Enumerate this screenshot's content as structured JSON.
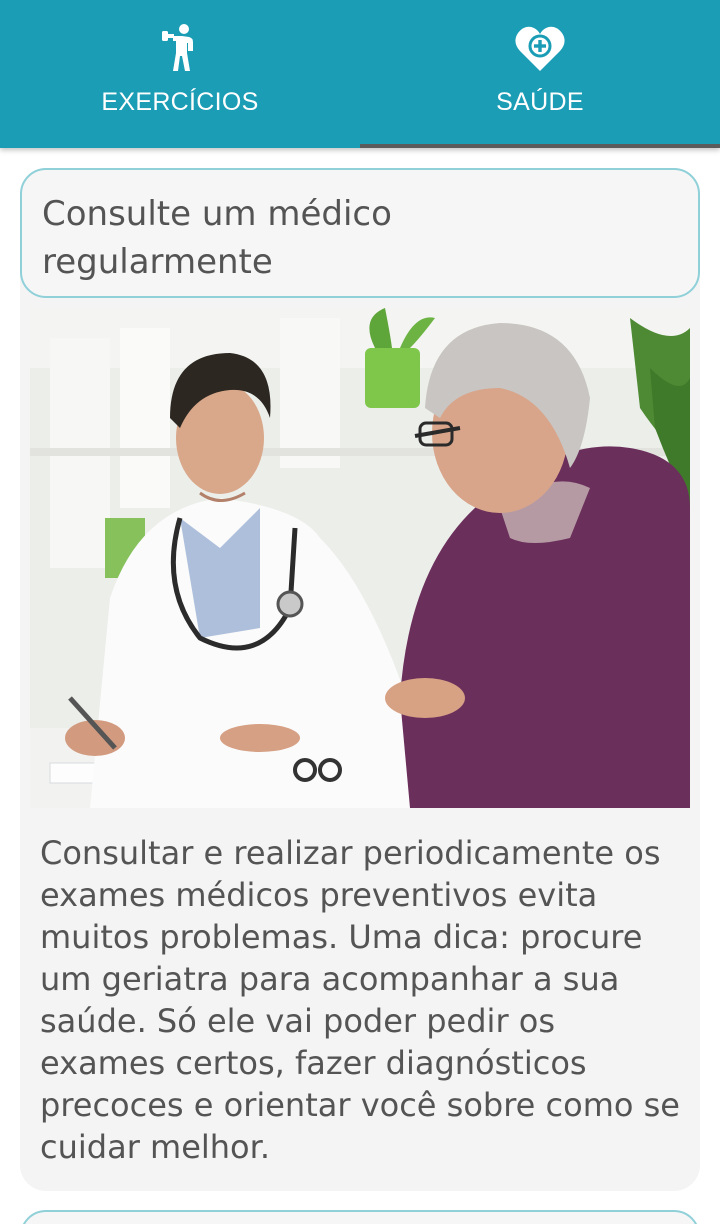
{
  "tabs": [
    {
      "label": "EXERCÍCIOS",
      "icon": "exercise-person-icon",
      "selected": false
    },
    {
      "label": "SAÚDE",
      "icon": "heart-plus-icon",
      "selected": true
    }
  ],
  "colors": {
    "primary": "#1a9db5",
    "indicator": "#5b5b5b",
    "card_border": "#8fd0d9",
    "card_bg": "#f4f4f4",
    "text": "#545454"
  },
  "card": {
    "title": "Consulte um médico regularmente",
    "image": "doctor-consulting-elderly-patient",
    "body": "Consultar e realizar periodicamente os exames médicos preventivos evita muitos problemas. Uma dica: procure um geriatra para acompanhar a sua saúde. Só ele vai poder pedir os exames certos, fazer diagnósticos precoces e orientar você sobre como se cuidar melhor."
  }
}
